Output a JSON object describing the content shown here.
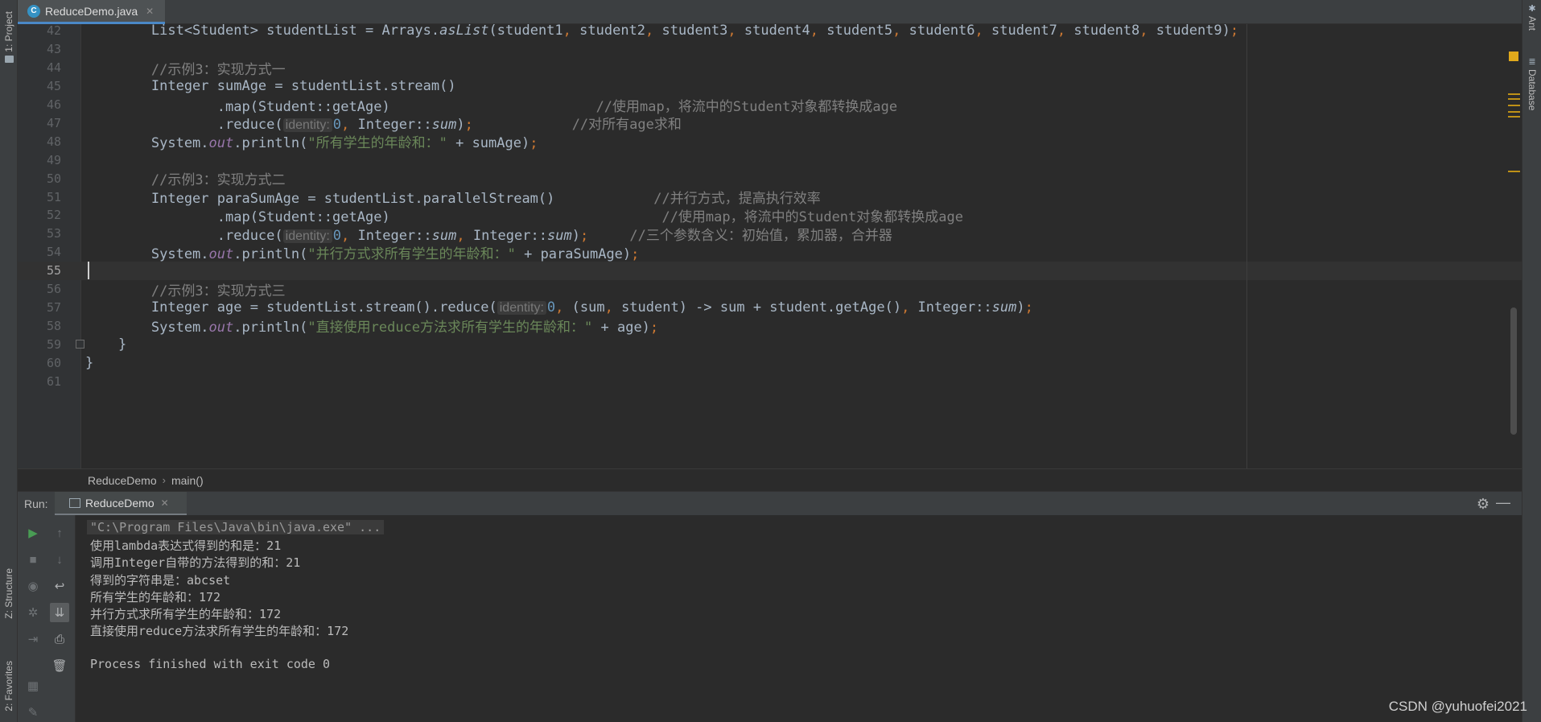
{
  "left_strip": {
    "project_tab": "1: Project",
    "structure_tab": "Z: Structure",
    "favorites_tab": "2: Favorites"
  },
  "right_strip": {
    "ant_tab": "Ant",
    "database_tab": "Database"
  },
  "editor_tab": {
    "label": "ReduceDemo.java",
    "icon": "java-class-icon"
  },
  "editor": {
    "current_line": 55,
    "lines": [
      {
        "n": "42",
        "segments": [
          {
            "t": "        List<Student> studentList = Arrays."
          },
          {
            "t": "asList",
            "c": "it"
          },
          {
            "t": "(student1"
          },
          {
            "t": ", ",
            "c": "kw"
          },
          {
            "t": "student2"
          },
          {
            "t": ", ",
            "c": "kw"
          },
          {
            "t": "student3"
          },
          {
            "t": ", ",
            "c": "kw"
          },
          {
            "t": "student4"
          },
          {
            "t": ", ",
            "c": "kw"
          },
          {
            "t": "student5"
          },
          {
            "t": ", ",
            "c": "kw"
          },
          {
            "t": "student6"
          },
          {
            "t": ", ",
            "c": "kw"
          },
          {
            "t": "student7"
          },
          {
            "t": ", ",
            "c": "kw"
          },
          {
            "t": "student8"
          },
          {
            "t": ", ",
            "c": "kw"
          },
          {
            "t": "student9)"
          },
          {
            "t": ";",
            "c": "kw"
          }
        ]
      },
      {
        "n": "43",
        "segments": []
      },
      {
        "n": "44",
        "segments": [
          {
            "t": "        //示例3：实现方式一",
            "c": "cm"
          }
        ]
      },
      {
        "n": "45",
        "segments": [
          {
            "t": "        Integer sumAge = studentList.stream()"
          }
        ]
      },
      {
        "n": "46",
        "segments": [
          {
            "t": "                .map(Student::getAge)                         "
          },
          {
            "t": "//使用map，将流中的Student对象都转换成age",
            "c": "cm"
          }
        ]
      },
      {
        "n": "47",
        "segments": [
          {
            "t": "                .reduce("
          },
          {
            "t": "identity:",
            "c": "hint"
          },
          {
            "t": "0",
            "c": "num"
          },
          {
            "t": ", ",
            "c": "kw"
          },
          {
            "t": "Integer::"
          },
          {
            "t": "sum",
            "c": "it"
          },
          {
            "t": ")"
          },
          {
            "t": ";",
            "c": "kw"
          },
          {
            "t": "            "
          },
          {
            "t": "//对所有age求和",
            "c": "cm"
          }
        ]
      },
      {
        "n": "48",
        "segments": [
          {
            "t": "        System."
          },
          {
            "t": "out",
            "c": "fld"
          },
          {
            "t": ".println("
          },
          {
            "t": "\"所有学生的年龄和：\"",
            "c": "str"
          },
          {
            "t": " + sumAge)"
          },
          {
            "t": ";",
            "c": "kw"
          }
        ]
      },
      {
        "n": "49",
        "segments": []
      },
      {
        "n": "50",
        "segments": [
          {
            "t": "        //示例3：实现方式二",
            "c": "cm"
          }
        ]
      },
      {
        "n": "51",
        "segments": [
          {
            "t": "        Integer paraSumAge = studentList.parallelStream()            "
          },
          {
            "t": "//并行方式，提高执行效率",
            "c": "cm"
          }
        ]
      },
      {
        "n": "52",
        "segments": [
          {
            "t": "                .map(Student::getAge)                                 "
          },
          {
            "t": "//使用map，将流中的Student对象都转换成age",
            "c": "cm"
          }
        ]
      },
      {
        "n": "53",
        "segments": [
          {
            "t": "                .reduce("
          },
          {
            "t": "identity:",
            "c": "hint"
          },
          {
            "t": "0",
            "c": "num"
          },
          {
            "t": ", ",
            "c": "kw"
          },
          {
            "t": "Integer::"
          },
          {
            "t": "sum",
            "c": "it"
          },
          {
            "t": ", ",
            "c": "kw"
          },
          {
            "t": "Integer::"
          },
          {
            "t": "sum",
            "c": "it"
          },
          {
            "t": ")"
          },
          {
            "t": ";",
            "c": "kw"
          },
          {
            "t": "     "
          },
          {
            "t": "//三个参数含义：初始值，累加器，合并器",
            "c": "cm"
          }
        ]
      },
      {
        "n": "54",
        "segments": [
          {
            "t": "        System."
          },
          {
            "t": "out",
            "c": "fld"
          },
          {
            "t": ".println("
          },
          {
            "t": "\"并行方式求所有学生的年龄和：\"",
            "c": "str"
          },
          {
            "t": " + paraSumAge)"
          },
          {
            "t": ";",
            "c": "kw"
          }
        ]
      },
      {
        "n": "55",
        "segments": []
      },
      {
        "n": "56",
        "segments": [
          {
            "t": "        //示例3：实现方式三",
            "c": "cm"
          }
        ]
      },
      {
        "n": "57",
        "segments": [
          {
            "t": "        Integer age = studentList.stream().reduce("
          },
          {
            "t": "identity:",
            "c": "hint"
          },
          {
            "t": "0",
            "c": "num"
          },
          {
            "t": ", ",
            "c": "kw"
          },
          {
            "t": "(sum"
          },
          {
            "t": ", ",
            "c": "kw"
          },
          {
            "t": "student) -> sum + student.getAge()"
          },
          {
            "t": ", ",
            "c": "kw"
          },
          {
            "t": "Integer::"
          },
          {
            "t": "sum",
            "c": "it"
          },
          {
            "t": ")"
          },
          {
            "t": ";",
            "c": "kw"
          }
        ]
      },
      {
        "n": "58",
        "segments": [
          {
            "t": "        System."
          },
          {
            "t": "out",
            "c": "fld"
          },
          {
            "t": ".println("
          },
          {
            "t": "\"直接使用reduce方法求所有学生的年龄和：\"",
            "c": "str"
          },
          {
            "t": " + age)"
          },
          {
            "t": ";",
            "c": "kw"
          }
        ]
      },
      {
        "n": "59",
        "segments": [
          {
            "t": "    }"
          }
        ]
      },
      {
        "n": "60",
        "segments": [
          {
            "t": "}"
          }
        ]
      },
      {
        "n": "61",
        "segments": []
      }
    ]
  },
  "breadcrumb": {
    "items": [
      "ReduceDemo",
      "main()"
    ]
  },
  "run_panel": {
    "label": "Run:",
    "tab_label": "ReduceDemo",
    "console_lines": [
      "\"C:\\Program Files\\Java\\bin\\java.exe\" ...",
      "使用lambda表达式得到的和是：21",
      "调用Integer自带的方法得到的和：21",
      "得到的字符串是：abcset",
      "所有学生的年龄和：172",
      "并行方式求所有学生的年龄和：172",
      "直接使用reduce方法求所有学生的年龄和：172",
      "",
      "Process finished with exit code 0"
    ]
  },
  "watermark": "CSDN @yuhuofei2021",
  "colors": {
    "background": "#2b2b2b",
    "panel": "#3c3f41",
    "comment": "#808080",
    "string": "#6a8759",
    "keyword": "#cc7832",
    "field": "#9876aa",
    "number": "#6897bb"
  }
}
